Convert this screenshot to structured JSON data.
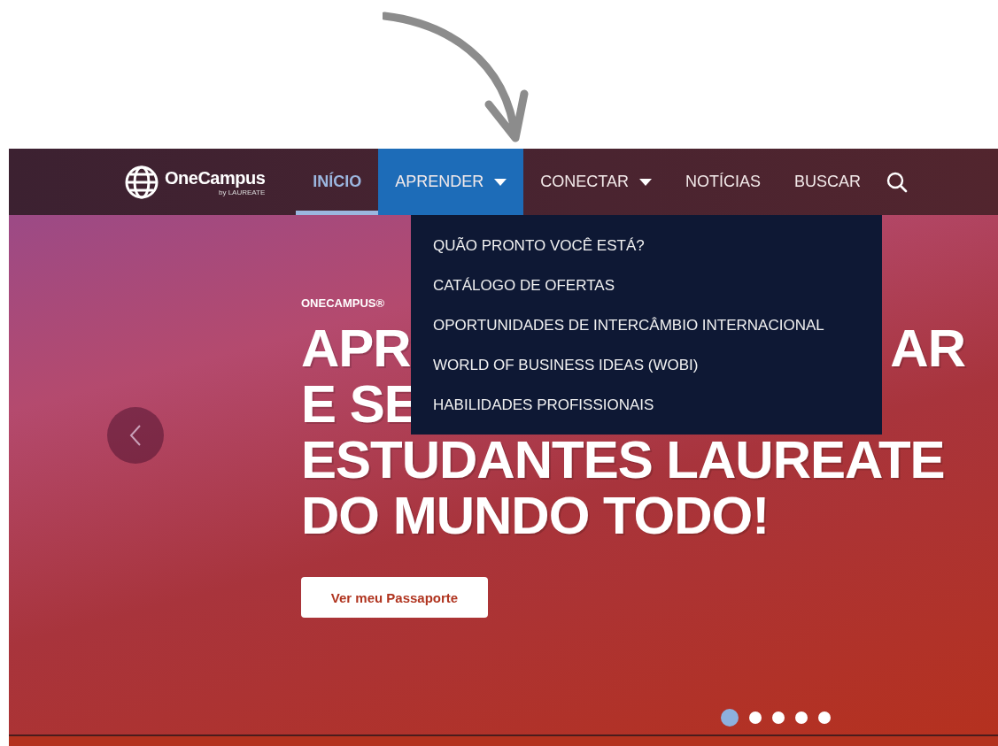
{
  "logo": {
    "name": "OneCampus",
    "byline": "by LAUREATE"
  },
  "nav": [
    {
      "label": "INÍCIO",
      "selected": true,
      "has_menu": false,
      "expanded": false
    },
    {
      "label": "APRENDER",
      "selected": false,
      "has_menu": true,
      "expanded": true
    },
    {
      "label": "CONECTAR",
      "selected": false,
      "has_menu": true,
      "expanded": false
    },
    {
      "label": "NOTÍCIAS",
      "selected": false,
      "has_menu": false,
      "expanded": false
    },
    {
      "label": "BUSCAR",
      "selected": false,
      "has_menu": false,
      "expanded": false
    }
  ],
  "dropdown": [
    "QUÃO PRONTO VOCÊ ESTÁ?",
    "CATÁLOGO DE OFERTAS",
    "OPORTUNIDADES DE INTERCÂMBIO INTERNACIONAL",
    "WORLD OF BUSINESS IDEAS (WOBI)",
    "HABILIDADES PROFISSIONAIS"
  ],
  "hero": {
    "eyebrow": "ONECAMPUS®",
    "headline_first": "APR",
    "headline_first_end": "AR",
    "headline_lines": [
      "E SE",
      "ESTUDANTES LAUREATE",
      "DO MUNDO TODO!"
    ],
    "button": "Ver meu Passaporte"
  },
  "slides": [
    {
      "selected": true
    },
    {
      "selected": false
    },
    {
      "selected": false
    },
    {
      "selected": false
    },
    {
      "selected": false
    }
  ]
}
